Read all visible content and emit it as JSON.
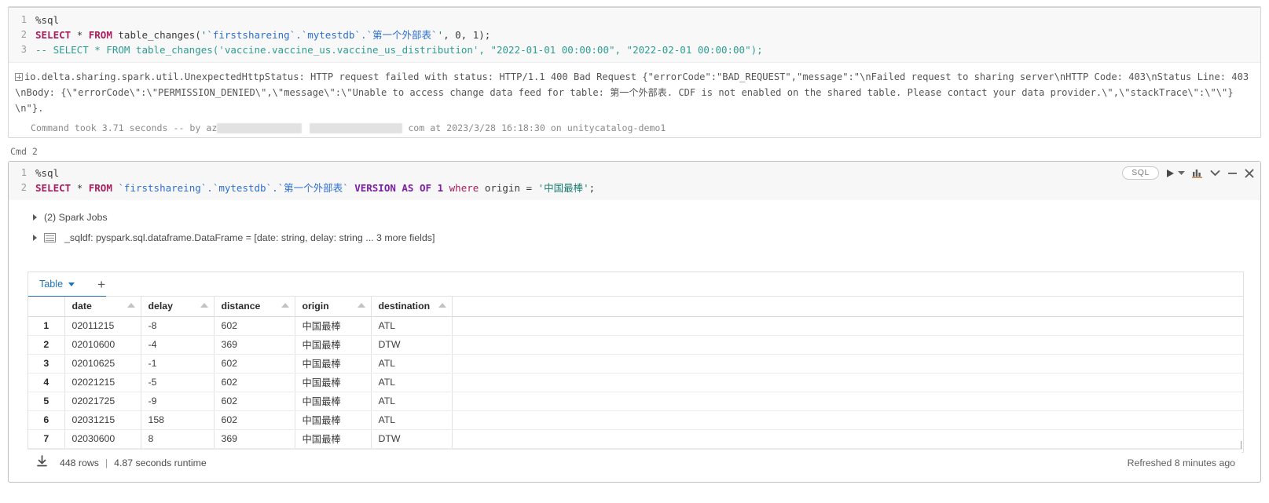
{
  "cell1": {
    "lines": [
      {
        "n": "1",
        "magic": "%sql"
      },
      {
        "n": "2",
        "kw": "SELECT",
        "star": "*",
        "from": "FROM",
        "fn": "table_changes(",
        "quote_open": "'",
        "id1": "`firstshareing`",
        "dot1": ".",
        "id2": "`mytestdb`",
        "dot2": ".",
        "id3": "`第一个外部表`",
        "quote_close": "'",
        "tail": ", 0, 1);"
      },
      {
        "n": "3",
        "comment": "-- SELECT * FROM table_changes('vaccine.vaccine_us.vaccine_us_distribution', \"2022-01-01 00:00:00\", \"2022-02-01 00:00:00\");"
      }
    ],
    "error_text": "io.delta.sharing.spark.util.UnexpectedHttpStatus: HTTP request failed with status: HTTP/1.1 400 Bad Request {\"errorCode\":\"BAD_REQUEST\",\"message\":\"\\nFailed request to sharing server\\nHTTP Code: 403\\nStatus Line: 403\\nBody: {\\\"errorCode\\\":\\\"PERMISSION_DENIED\\\",\\\"message\\\":\\\"Unable to access change data feed for table: 第一个外部表. CDF is not enabled on the shared table. Please contact your data provider.\\\",\\\"stackTrace\\\":\\\"\\\"}\\n\"}.",
    "status_prefix": "Command took 3.71 seconds -- by az",
    "status_mid": "com at 2023/3/28 16:18:30 on unitycatalog-demo1"
  },
  "cmd_label": "Cmd 2",
  "cell2": {
    "toolbar": {
      "language": "SQL",
      "run_icon": "play-icon",
      "run_caret_icon": "caret-down-icon",
      "chart_icon": "bar-chart-icon",
      "chevron_icon": "chevron-down-icon",
      "minimize_icon": "minimize-icon",
      "close_icon": "close-icon"
    },
    "lines": [
      {
        "n": "1",
        "magic": "%sql"
      },
      {
        "n": "2",
        "kw": "SELECT",
        "star": "*",
        "from": "FROM",
        "id1": "`firstshareing`",
        "dot1": ".",
        "id2": "`mytestdb`",
        "dot2": ".",
        "id3": "`第一个外部表`",
        "version": "VERSION AS OF",
        "ver_num": "1",
        "where": "where",
        "col": "origin",
        "eq": "=",
        "val": "'中国最棒'",
        "semi": ";"
      }
    ],
    "spark_jobs": "(2) Spark Jobs",
    "dataframe": "_sqldf: pyspark.sql.dataframe.DataFrame = [date: string, delay: string ... 3 more fields]",
    "results": {
      "tab_label": "Table",
      "add_tab_label": "+",
      "columns": [
        "",
        "date",
        "delay",
        "distance",
        "origin",
        "destination",
        ""
      ],
      "rows": [
        {
          "n": "1",
          "date": "02011215",
          "delay": "-8",
          "distance": "602",
          "origin": "中国最棒",
          "destination": "ATL"
        },
        {
          "n": "2",
          "date": "02010600",
          "delay": "-4",
          "distance": "369",
          "origin": "中国最棒",
          "destination": "DTW"
        },
        {
          "n": "3",
          "date": "02010625",
          "delay": "-1",
          "distance": "602",
          "origin": "中国最棒",
          "destination": "ATL"
        },
        {
          "n": "4",
          "date": "02021215",
          "delay": "-5",
          "distance": "602",
          "origin": "中国最棒",
          "destination": "ATL"
        },
        {
          "n": "5",
          "date": "02021725",
          "delay": "-9",
          "distance": "602",
          "origin": "中国最棒",
          "destination": "ATL"
        },
        {
          "n": "6",
          "date": "02031215",
          "delay": "158",
          "distance": "602",
          "origin": "中国最棒",
          "destination": "ATL"
        },
        {
          "n": "7",
          "date": "02030600",
          "delay": "8",
          "distance": "369",
          "origin": "中国最棒",
          "destination": "DTW"
        }
      ],
      "footer": {
        "download_icon": "download-icon",
        "rows_count": "448 rows",
        "separator": "|",
        "runtime": "4.87 seconds runtime",
        "refreshed": "Refreshed 8 minutes ago"
      }
    }
  },
  "colors": {
    "accent": "#2272b4",
    "keyword": "#a71d5d",
    "string": "#1b7b6e",
    "ident": "#2f6fd0",
    "comment": "#2e9d8f"
  }
}
